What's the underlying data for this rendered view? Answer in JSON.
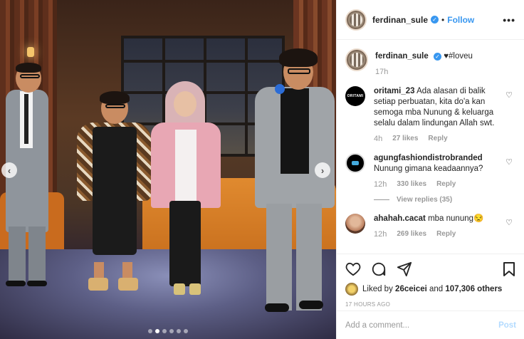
{
  "post": {
    "username": "ferdinan_sule",
    "separator": "•",
    "follow_label": "Follow",
    "more_label": "•••",
    "verified_glyph": "✓",
    "caption": {
      "username": "ferdinan_sule",
      "text": "♥#loveu",
      "time": "17h"
    },
    "comments": [
      {
        "username": "oritami_23",
        "avatar_text": "ORITAMI",
        "text": "Ada alasan di balik setiap perbuatan, kita do'a kan semoga mba Nunung & keluarga selalu dalam lindungan Allah swt.",
        "time": "4h",
        "likes": "27 likes",
        "reply": "Reply"
      },
      {
        "username": "agungfashiondistrobranded",
        "text": "Nunung gimana keadaannya?",
        "time": "12h",
        "likes": "330 likes",
        "reply": "Reply",
        "view_replies": "View replies (35)"
      },
      {
        "username": "ahahah.cacat",
        "text": "mba nunung😒",
        "time": "12h",
        "likes": "269 likes",
        "reply": "Reply"
      }
    ],
    "likes": {
      "prefix": "Liked by",
      "user": "26ceicei",
      "and": "and",
      "others": "107,306 others"
    },
    "timestamp": "17 HOURS AGO",
    "add_comment_placeholder": "Add a comment...",
    "post_label": "Post",
    "heart_glyph": "♡",
    "carousel": {
      "prev": "‹",
      "next": "›",
      "total_dots": 6,
      "active_dot": 1
    }
  },
  "colors": {
    "accent": "#3897f0",
    "muted": "#999999",
    "post_disabled": "#b3dbff"
  }
}
